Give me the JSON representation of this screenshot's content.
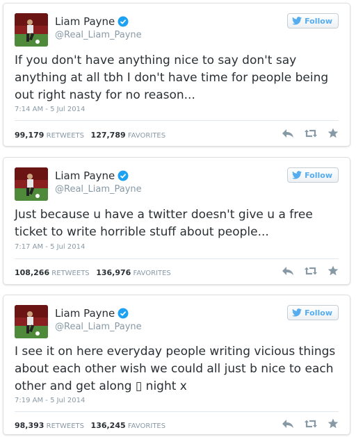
{
  "follow_label": "Follow",
  "stats_labels": {
    "retweets": "RETWEETS",
    "favorites": "FAVORITES"
  },
  "colors": {
    "brand": "#55acee",
    "verified": "#1da1f2",
    "muted": "#8899a6",
    "text": "#292f33"
  },
  "tweets": [
    {
      "name": "Liam Payne",
      "handle": "@Real_Liam_Payne",
      "text": "If you don't have anything nice to say don't say anything at all tbh I don't have time for people being out right nasty for no reason...",
      "time": "7:14 AM - 5 Jul 2014",
      "retweets": "99,179",
      "favorites": "127,789"
    },
    {
      "name": "Liam Payne",
      "handle": "@Real_Liam_Payne",
      "text": "Just because u have a twitter doesn't give u a free ticket to write horrible stuff about people...",
      "time": "7:17 AM - 5 Jul 2014",
      "retweets": "108,266",
      "favorites": "136,976"
    },
    {
      "name": "Liam Payne",
      "handle": "@Real_Liam_Payne",
      "text": "I see it on here everyday people writing vicious things about each other wish we could all just b nice to each other and get along ▯ night x",
      "time": "7:19 AM - 5 Jul 2014",
      "retweets": "98,393",
      "favorites": "136,245"
    }
  ]
}
